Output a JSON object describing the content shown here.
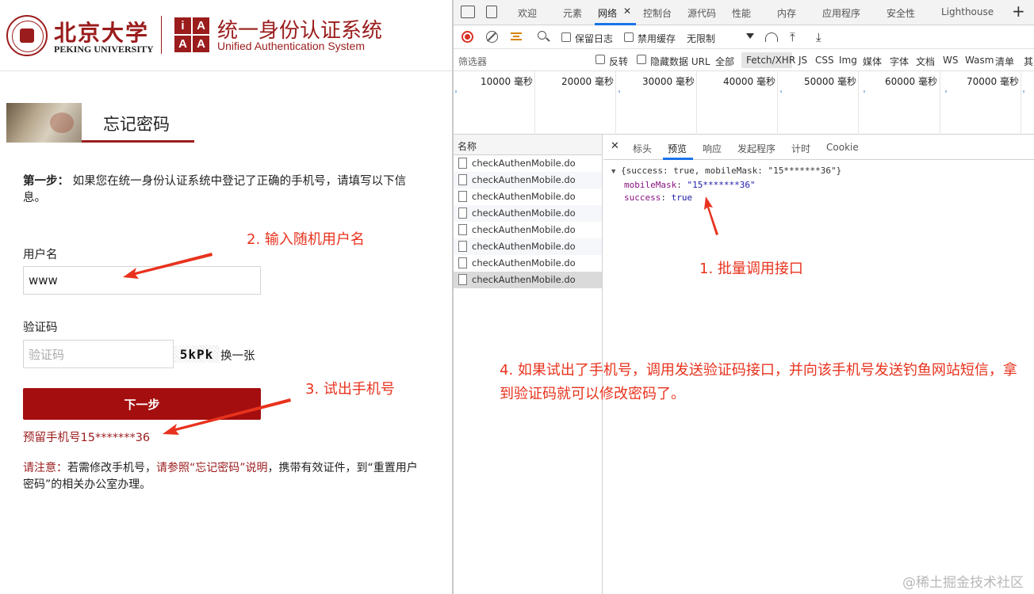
{
  "page": {
    "university_cn": "北京大学",
    "university_en": "PEKING UNIVERSITY",
    "iaaa_letters": [
      "i",
      "A",
      "A",
      "A"
    ],
    "system_cn": "统一身份认证系统",
    "system_en": "Unified Authentication System",
    "forgot_title": "忘记密码",
    "step_label": "第一步：",
    "step_text": " 如果您在统一身份认证系统中登记了正确的手机号，请填写以下信息。",
    "username_label": "用户名",
    "username_value": "www",
    "captcha_label": "验证码",
    "captcha_placeholder": "验证码",
    "captcha_image_text": "5kPk",
    "captcha_refresh": "换一张",
    "next_button": "下一步",
    "reserved_phone": "预留手机号15*******36",
    "notice_prefix": "请注意：",
    "notice_mid1": "若需修改手机号，",
    "notice_link": "请参照“忘记密码”说明",
    "notice_rest": "，携带有效证件，到“重置用户密码”的相关办公室办理。"
  },
  "devtools": {
    "tabs": [
      "欢迎",
      "元素",
      "网络",
      "控制台",
      "源代码",
      "性能",
      "内存",
      "应用程序",
      "安全性",
      "Lighthouse"
    ],
    "active_tab": "网络",
    "tab_close": "✕",
    "plus": "+",
    "toolbar": {
      "preserve_log": "保留日志",
      "disable_cache": "禁用缓存",
      "throttle": "无限制",
      "upload": "⤒",
      "download": "⤓"
    },
    "filterbar": {
      "filter_label": "筛选器",
      "invert": "反转",
      "hide_data_urls": "隐藏数据 URL",
      "types": [
        "全部",
        "Fetch/XHR",
        "JS",
        "CSS",
        "Img",
        "媒体",
        "字体",
        "文档",
        "WS",
        "Wasm",
        "清单",
        "其"
      ],
      "active_type": "Fetch/XHR"
    },
    "timeline_labels": [
      "10000  毫秒",
      "20000  毫秒",
      "30000  毫秒",
      "40000  毫秒",
      "50000  毫秒",
      "60000  毫秒",
      "70000  毫秒"
    ],
    "list_header": "名称",
    "requests": [
      "checkAuthenMobile.do",
      "checkAuthenMobile.do",
      "checkAuthenMobile.do",
      "checkAuthenMobile.do",
      "checkAuthenMobile.do",
      "checkAuthenMobile.do",
      "checkAuthenMobile.do",
      "checkAuthenMobile.do"
    ],
    "detail_tabs": [
      "标头",
      "预览",
      "响应",
      "发起程序",
      "计时",
      "Cookie"
    ],
    "active_detail_tab": "预览",
    "detail_close": "✕",
    "preview": {
      "summary": "{success: true, mobileMask: \"15*******36\"}",
      "key1": "mobileMask",
      "val1": "\"15*******36\"",
      "key2": "success",
      "val2": "true"
    }
  },
  "annotations": {
    "a1": "1. 批量调用接口",
    "a2": "2. 输入随机用户名",
    "a3": "3. 试出手机号",
    "a4": "4. 如果试出了手机号，调用发送验证码接口，并向该手机号发送钓鱼网站短信，拿到验证码就可以修改密码了。"
  },
  "watermark": "@稀土掘金技术社区",
  "colors": {
    "brand_red": "#9b1c1c",
    "button_red": "#a50e0e",
    "annotation_red": "#e8321d",
    "devtools_blue": "#1a73e8"
  }
}
